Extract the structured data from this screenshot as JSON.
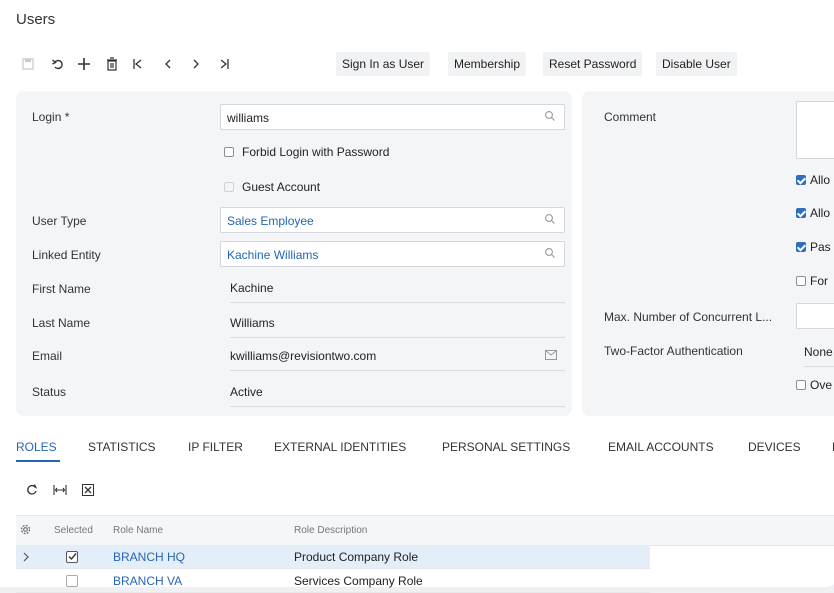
{
  "page": {
    "title": "Users"
  },
  "toolbar": {
    "icons": [
      "save-icon",
      "undo-icon",
      "add-icon",
      "delete-icon",
      "first-icon",
      "prev-icon",
      "next-icon",
      "last-icon"
    ],
    "buttons": {
      "sign_in_as_user": "Sign In as User",
      "membership": "Membership",
      "reset_password": "Reset Password",
      "disable_user": "Disable User"
    }
  },
  "form": {
    "login": {
      "label": "Login *",
      "value": "williams"
    },
    "forbid_login": {
      "label": "Forbid Login with Password",
      "checked": false
    },
    "guest_account": {
      "label": "Guest Account",
      "checked": false,
      "disabled": true
    },
    "user_type": {
      "label": "User Type",
      "value": "Sales Employee"
    },
    "linked_entity": {
      "label": "Linked Entity",
      "value": "Kachine Williams"
    },
    "first_name": {
      "label": "First Name",
      "value": "Kachine"
    },
    "last_name": {
      "label": "Last Name",
      "value": "Williams"
    },
    "email": {
      "label": "Email",
      "value": "kwilliams@revisiontwo.com"
    },
    "status": {
      "label": "Status",
      "value": "Active"
    }
  },
  "right_panel": {
    "comment_label": "Comment",
    "checkboxes": [
      {
        "label": "Allo",
        "checked": true
      },
      {
        "label": "Allo",
        "checked": true
      },
      {
        "label": "Pas",
        "checked": true
      },
      {
        "label": "For",
        "checked": false
      }
    ],
    "max_concurrent_label": "Max. Number of Concurrent L...",
    "two_factor_label": "Two-Factor Authentication",
    "two_factor_value": "None",
    "override": {
      "label": "Ove",
      "checked": false
    }
  },
  "tabs": [
    {
      "label": "ROLES",
      "active": true
    },
    {
      "label": "STATISTICS"
    },
    {
      "label": "IP FILTER"
    },
    {
      "label": "EXTERNAL IDENTITIES"
    },
    {
      "label": "PERSONAL SETTINGS"
    },
    {
      "label": "EMAIL ACCOUNTS"
    },
    {
      "label": "DEVICES"
    },
    {
      "label": "L"
    }
  ],
  "grid": {
    "columns": {
      "selected": "Selected",
      "role_name": "Role Name",
      "role_description": "Role Description"
    },
    "rows": [
      {
        "selected": true,
        "role_name": "BRANCH HQ",
        "role_description": "Product Company Role"
      },
      {
        "selected": false,
        "role_name": "BRANCH VA",
        "role_description": "Services Company Role"
      }
    ]
  },
  "colors": {
    "accent": "#2566b4",
    "selected_row": "#e3eef9",
    "panel_bg": "#f4f5f7"
  }
}
